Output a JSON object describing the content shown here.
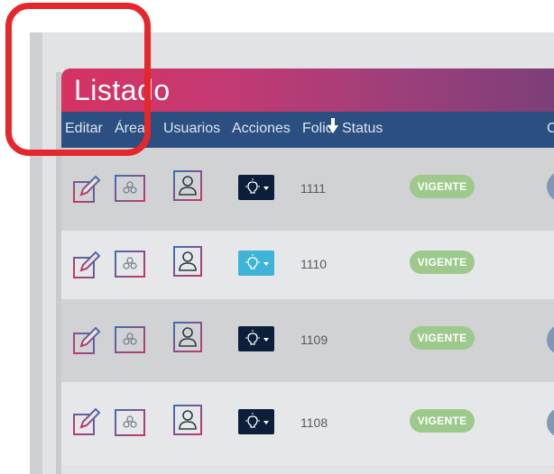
{
  "window": {
    "title": "Listado"
  },
  "columns": [
    {
      "label": "Editar"
    },
    {
      "label": "Área"
    },
    {
      "label": "Usuarios"
    },
    {
      "label": "Acciones"
    },
    {
      "label": "Folio"
    },
    {
      "label": "Status"
    },
    {
      "label": "C"
    }
  ],
  "rows": [
    {
      "folio": "1111",
      "status": "VIGENTE",
      "action_button": "dark"
    },
    {
      "folio": "1110",
      "status": "VIGENTE",
      "action_button": "light"
    },
    {
      "folio": "1109",
      "status": "VIGENTE",
      "action_button": "dark"
    },
    {
      "folio": "1108",
      "status": "VIGENTE",
      "action_button": "dark"
    }
  ],
  "icons": {
    "edit": "edit-icon",
    "area": "group-icon",
    "users": "user-icon",
    "actions": "lightbulb-icon",
    "sort": "sort-down-icon"
  },
  "colors": {
    "header_start": "#d63262",
    "header_end": "#7c3f78",
    "column_bar": "#2a4f80",
    "status_badge": "#9ec98c",
    "action_dark": "#0b1f3a",
    "action_light": "#3fb3d8",
    "highlight": "#e5262b"
  }
}
